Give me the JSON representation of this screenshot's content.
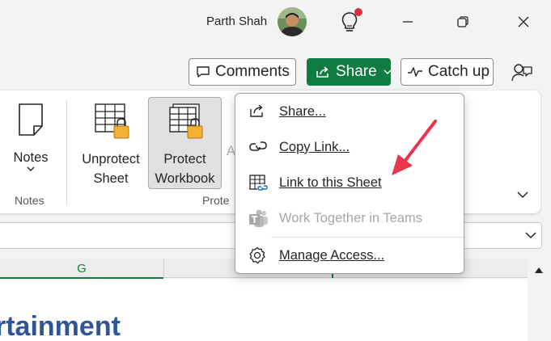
{
  "titlebar": {
    "user_name": "Parth Shah"
  },
  "actions": {
    "comments_label": "Comments",
    "share_label": "Share",
    "catchup_label": "Catch up"
  },
  "ribbon": {
    "notes_label": "Notes",
    "notes_group": "Notes",
    "unprotect_line1": "Unprotect",
    "unprotect_line2": "Sheet",
    "protect_line1": "Protect",
    "protect_line2": "Workbook",
    "protect_group_partial": "Prote",
    "partial_letter": "A"
  },
  "share_menu": {
    "items": [
      {
        "label": "Share...",
        "icon": "share-icon",
        "enabled": true
      },
      {
        "label": "Copy Link...",
        "icon": "link-icon",
        "enabled": true
      },
      {
        "label": "Link to this Sheet",
        "icon": "sheet-link-icon",
        "enabled": true
      },
      {
        "label": "Work Together in Teams",
        "icon": "teams-icon",
        "enabled": false
      },
      {
        "label": "Manage Access...",
        "icon": "gear-icon",
        "enabled": true
      }
    ]
  },
  "grid": {
    "column_g": "G",
    "cell_text": "rtainment"
  },
  "colors": {
    "share_green": "#107c41",
    "arrow_red": "#e8364c",
    "notification_red": "#d13438",
    "cell_text_blue": "#2f5597"
  }
}
